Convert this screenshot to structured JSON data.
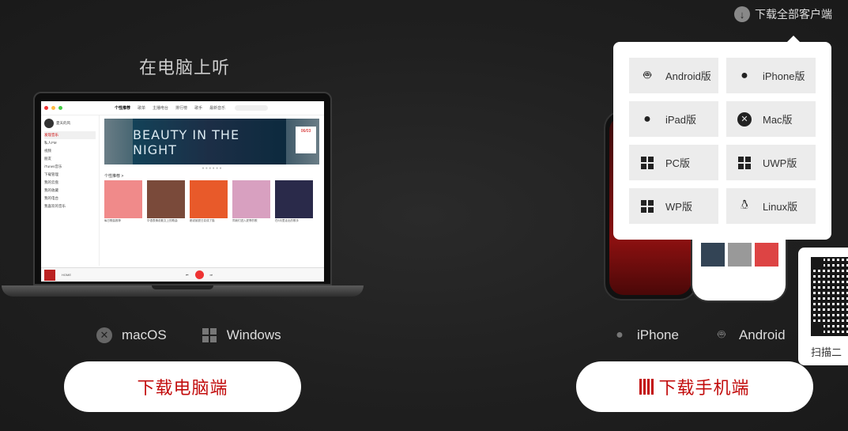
{
  "header": {
    "download_all_label": "下载全部客户端"
  },
  "pc": {
    "title": "在电脑上听",
    "os": [
      {
        "icon": "x-circle-icon",
        "label": "macOS"
      },
      {
        "icon": "windows-icon",
        "label": "Windows"
      }
    ],
    "button_label": "下载电脑端"
  },
  "mobile": {
    "os": [
      {
        "icon": "apple-icon",
        "label": "iPhone"
      },
      {
        "icon": "android-icon",
        "label": "Android"
      }
    ],
    "button_label": "下载手机端"
  },
  "dropdown": {
    "items": [
      {
        "icon": "android-icon",
        "label": "Android版"
      },
      {
        "icon": "apple-icon",
        "label": "iPhone版"
      },
      {
        "icon": "apple-icon",
        "label": "iPad版"
      },
      {
        "icon": "x-circle-icon",
        "label": "Mac版"
      },
      {
        "icon": "windows-icon",
        "label": "PC版"
      },
      {
        "icon": "windows-icon",
        "label": "UWP版"
      },
      {
        "icon": "windows-icon",
        "label": "WP版"
      },
      {
        "icon": "linux-icon",
        "label": "Linux版"
      }
    ]
  },
  "qr": {
    "caption": "扫描二"
  },
  "laptop_app": {
    "tabs": [
      "个性推荐",
      "歌单",
      "主播电台",
      "排行榜",
      "歌手",
      "最新音乐"
    ],
    "user": "夏天的风",
    "side_items": [
      "发现音乐",
      "私人FM",
      "视频",
      "朋友",
      "iTunes音乐",
      "下载管理",
      "我的云盘",
      "我的收藏",
      "我的电台",
      "我喜欢的音乐"
    ],
    "banner_text": "BEAUTY IN THE NIGHT",
    "banner_date": "06/03",
    "rec_title": "个性推荐 >",
    "covers": [
      {
        "caption": "每日歌曲推荐",
        "color": "#f08a8a"
      },
      {
        "caption": "华语表情说散文上的歌曲",
        "color": "#7a4a3a"
      },
      {
        "caption": "都说被夏日变成了猫",
        "color": "#e85a2a"
      },
      {
        "caption": "同我们进入夏季的歌",
        "color": "#d8a0c0"
      },
      {
        "caption": "在5月里走出的歌手",
        "color": "#2a2a4a"
      }
    ],
    "player_track": "HOME",
    "colors": {
      "brand": "#c20c0c"
    }
  }
}
